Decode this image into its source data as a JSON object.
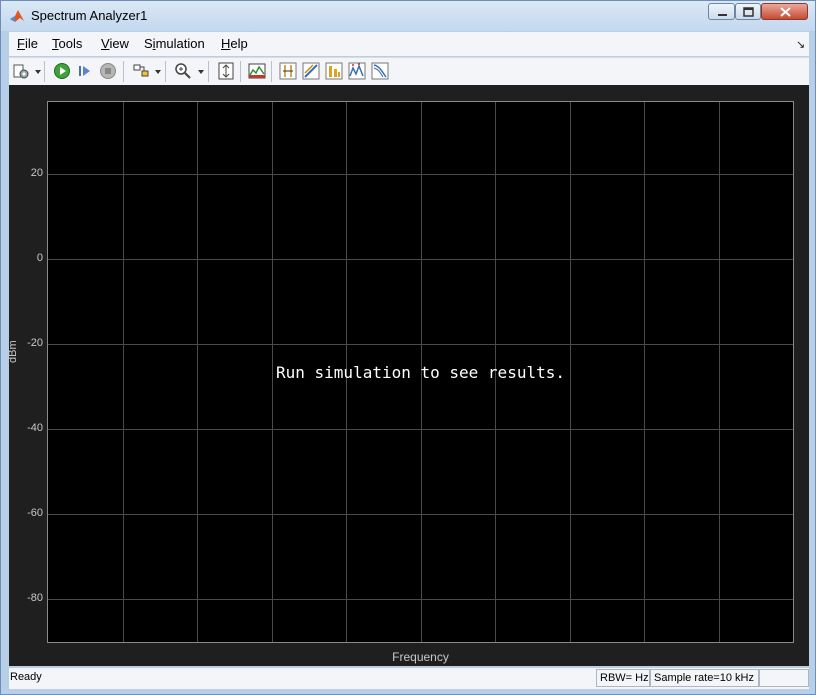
{
  "window": {
    "title": "Spectrum Analyzer1"
  },
  "menu": {
    "items": [
      {
        "key": "F",
        "rest": "ile"
      },
      {
        "key": "T",
        "rest": "ools"
      },
      {
        "key": "V",
        "rest": "iew"
      },
      {
        "pre": "S",
        "key": "i",
        "rest": "mulation"
      },
      {
        "key": "H",
        "rest": "elp"
      }
    ]
  },
  "toolbar": {
    "icons": [
      "settings-icon",
      "run-icon",
      "step-forward-icon",
      "stop-icon",
      "highlight-block-icon",
      "zoom-in-icon",
      "scale-axes-icon",
      "spectrum-settings-icon",
      "cursor-measurements-icon",
      "channel-measurements-icon",
      "distortion-measurements-icon",
      "peak-finder-icon",
      "ccdf-measurements-icon"
    ]
  },
  "plot": {
    "message": "Run simulation to see results.",
    "xlabel": "Frequency",
    "ylabel": "dBm",
    "yticks": [
      "20",
      "0",
      "-20",
      "-40",
      "-60",
      "-80"
    ]
  },
  "chart_data": {
    "type": "line",
    "xlabel": "Frequency",
    "ylabel": "dBm",
    "yticks": [
      20,
      0,
      -20,
      -40,
      -60,
      -80
    ],
    "ylim": [
      -90,
      37
    ],
    "grid": true,
    "series": []
  },
  "status": {
    "text": "Ready",
    "rbw": "RBW= Hz",
    "sample_rate": "Sample rate=10 kHz",
    "extra": ""
  },
  "colors": {
    "plot_bg": "#000000",
    "frame_bg": "#1f1f1f",
    "grid": "#4a4a4a"
  }
}
